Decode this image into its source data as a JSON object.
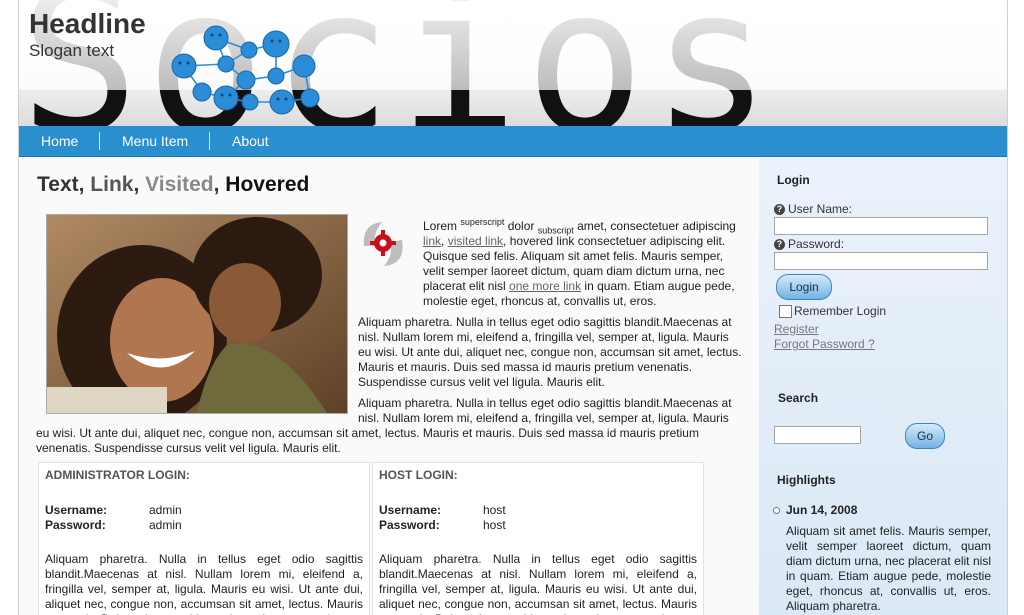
{
  "header": {
    "title": "Headline",
    "slogan": "Slogan text",
    "banner_word": "Socios"
  },
  "nav": [
    "Home",
    "Menu Item",
    "About"
  ],
  "content": {
    "heading": {
      "text": "Text",
      "link": "Link",
      "visited": "Visited",
      "hovered": "Hovered"
    },
    "p1": {
      "t1": "Lorem ",
      "sup": "superscript",
      "t2": " dolor ",
      "sub": "subscript",
      "t3": " amet, consectetuer adipiscing ",
      "link": "link",
      "visited_link": "visited link",
      "t4": ", hovered link consectetuer adipiscing elit. Quisque sed felis. Aliquam sit amet felis. Mauris semper, velit semper laoreet dictum, quam diam dictum urna, nec placerat elit nisl ",
      "one_more_link": "one more link",
      "t5": " in quam. Etiam augue pede, molestie eget, rhoncus at, convallis ut, eros."
    },
    "p2": "Aliquam pharetra. Nulla in tellus eget odio sagittis blandit.Maecenas at nisl. Nullam lorem mi, eleifend a, fringilla vel, semper at, ligula. Mauris eu wisi. Ut ante dui, aliquet nec, congue non, accumsan sit amet, lectus. Mauris et mauris. Duis sed massa id mauris pretium venenatis. Suspendisse cursus velit vel ligula. Mauris elit.",
    "p3_line1": "Aliquam pharetra. Nulla in tellus eget odio sagittis blandit.Maecenas at",
    "p3_line2": "nisl. Nullam lorem mi, eleifend a, fringilla vel, semper at, ligula. Mauris",
    "p3_rest": "eu wisi. Ut ante dui, aliquet nec, congue non, accumsan sit amet, lectus. Mauris et mauris. Duis sed massa id mauris pretium venenatis. Suspendisse cursus velit vel ligula. Mauris elit."
  },
  "admin_login": {
    "title": "ADMINISTRATOR LOGIN:",
    "username_label": "Username:",
    "username": "admin",
    "password_label": "Password:",
    "password": "admin",
    "text": "Aliquam pharetra. Nulla in tellus eget odio sagittis blandit.Maecenas at nisl. Nullam lorem mi, eleifend a, fringilla vel, semper at, ligula. Mauris eu wisi. Ut ante dui, aliquet nec, congue non, accumsan sit amet, lectus. Mauris et mauris. Duis sed massa id mauris pretium venenatis."
  },
  "host_login": {
    "title": "HOST LOGIN:",
    "username_label": "Username:",
    "username": "host",
    "password_label": "Password:",
    "password": "host",
    "text": "Aliquam pharetra. Nulla in tellus eget odio sagittis blandit.Maecenas at nisl. Nullam lorem mi, eleifend a, fringilla vel, semper at, ligula. Mauris eu wisi. Ut ante dui, aliquet nec, congue non, accumsan sit amet, lectus. Mauris et mauris. Duis sed massa id mauris pretium venenatis."
  },
  "sidebar": {
    "login_title": "Login",
    "username_label": "User Name:",
    "password_label": "Password:",
    "login_button": "Login",
    "remember": "Remember Login",
    "register": "Register",
    "forgot": "Forgot Password ?",
    "search_title": "Search",
    "go_button": "Go",
    "highlights_title": "Highlights",
    "highlight_date": "Jun 14, 2008",
    "highlight_text": "Aliquam sit amet felis. Mauris semper, velit semper laoreet dictum, quam diam dictum urna, nec placerat elit nisl in quam. Etiam augue pede, molestie eget, rhoncus at, convallis ut, eros. Aliquam pharetra."
  },
  "colors": {
    "nav": "#2a8fce",
    "sidebar": "#dbe8f6",
    "molecule": "#2b8dd8"
  }
}
